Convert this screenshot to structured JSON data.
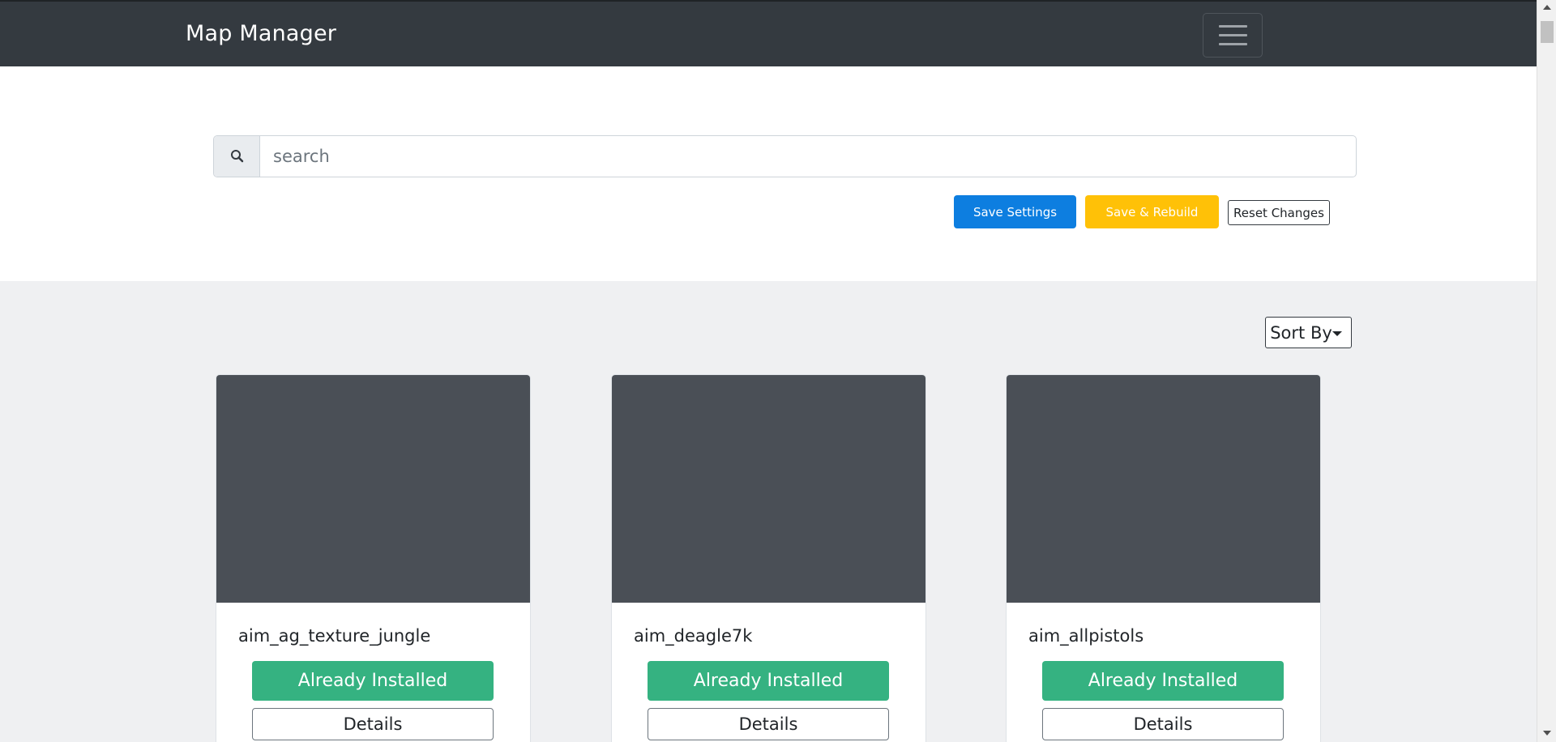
{
  "navbar": {
    "brand": "Map Manager",
    "toggler_icon": "hamburger-icon"
  },
  "search": {
    "placeholder": "search",
    "value": "",
    "icon": "search-icon"
  },
  "actions": {
    "save_label": "Save Settings",
    "rebuild_label": "Save & Rebuild",
    "reset_label": "Reset Changes"
  },
  "sort": {
    "label": "Sort By"
  },
  "colors": {
    "navbar": "#343a40",
    "primary": "#0d7ee0",
    "warning": "#ffc107",
    "success": "#35b281",
    "background": "#eff0f2"
  },
  "maps": [
    {
      "name": "aim_ag_texture_jungle",
      "status_label": "Already Installed",
      "details_label": "Details"
    },
    {
      "name": "aim_deagle7k",
      "status_label": "Already Installed",
      "details_label": "Details"
    },
    {
      "name": "aim_allpistols",
      "status_label": "Already Installed",
      "details_label": "Details"
    }
  ]
}
